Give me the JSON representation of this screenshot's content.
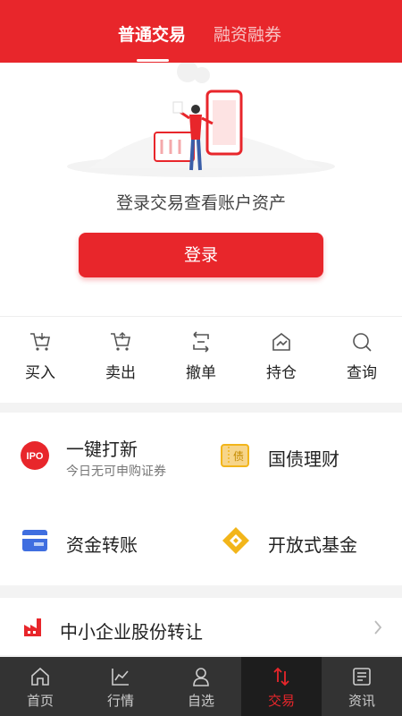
{
  "header": {
    "tab_active": "普通交易",
    "tab_inactive": "融资融券"
  },
  "hero": {
    "login_prompt": "登录交易查看账户资产",
    "login_button": "登录"
  },
  "quick_actions": [
    {
      "label": "买入",
      "icon": "cart-in-icon"
    },
    {
      "label": "卖出",
      "icon": "cart-out-icon"
    },
    {
      "label": "撤单",
      "icon": "cancel-order-icon"
    },
    {
      "label": "持仓",
      "icon": "holdings-icon"
    },
    {
      "label": "查询",
      "icon": "query-icon"
    }
  ],
  "services": {
    "ipo": {
      "badge": "IPO",
      "title": "一键打新",
      "subtitle": "今日无可申购证券"
    },
    "bond": {
      "badge": "债",
      "title": "国债理财"
    },
    "transfer": {
      "title": "资金转账"
    },
    "fund": {
      "title": "开放式基金"
    }
  },
  "sme": {
    "title": "中小企业股份转让"
  },
  "bottom_nav": [
    {
      "label": "首页",
      "icon": "home-icon"
    },
    {
      "label": "行情",
      "icon": "market-icon"
    },
    {
      "label": "自选",
      "icon": "watchlist-icon"
    },
    {
      "label": "交易",
      "icon": "trade-icon"
    },
    {
      "label": "资讯",
      "icon": "news-icon"
    }
  ],
  "colors": {
    "accent": "#e8262b",
    "nav_bg": "#333333",
    "gold": "#f2b51a",
    "blue": "#3f6ee0"
  }
}
